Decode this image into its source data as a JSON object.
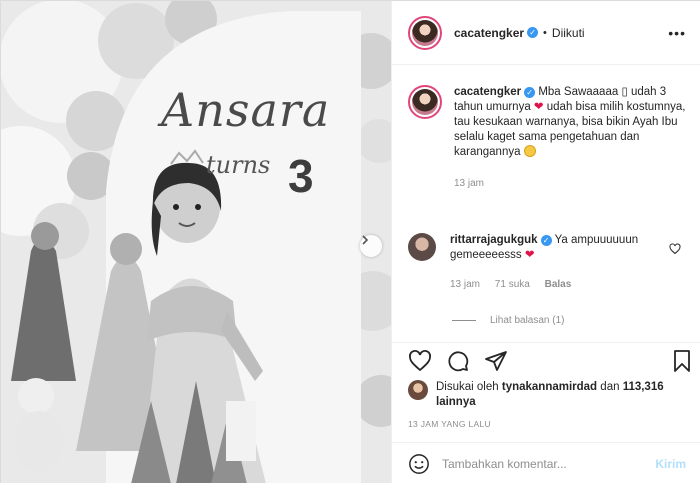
{
  "header": {
    "username": "cacatengker",
    "separator": "•",
    "follow_status": "Diikuti"
  },
  "photo": {
    "banner_name": "Ansara",
    "banner_turns": "turns",
    "banner_age": "3"
  },
  "caption": {
    "username": "cacatengker",
    "text_1": "Mba Sawaaaaa",
    "text_2": "udah 3 tahun umurnya",
    "text_3": "udah bisa milih kostumnya, tau kesukaan warnanya, bisa bikin Ayah Ibu selalu kaget sama pengetahuan dan karangannya",
    "time": "13 jam"
  },
  "comment": {
    "username": "rittarrajagukguk",
    "text": "Ya ampuuuuuun gemeeeeesss",
    "time": "13 jam",
    "likes": "71 suka",
    "reply": "Balas",
    "view_replies": "Lihat balasan (1)"
  },
  "likes": {
    "prefix": "Disukai oleh",
    "user": "tynakannamirdad",
    "middle": "dan",
    "count": "113,316",
    "suffix": "lainnya"
  },
  "posted_time": "13 JAM YANG LALU",
  "add_comment": {
    "placeholder": "Tambahkan komentar...",
    "submit": "Kirim"
  },
  "icons": {
    "verified": "verified-badge-icon",
    "heart": "heart-icon",
    "comment": "comment-icon",
    "share": "share-icon",
    "save": "bookmark-icon",
    "emoji": "smile-icon",
    "next": "chevron-right-icon"
  },
  "colors": {
    "story_ring": "#e0457b",
    "verified": "#3897f0",
    "heart": "#e0144c",
    "post_disabled": "#b2dffc"
  }
}
